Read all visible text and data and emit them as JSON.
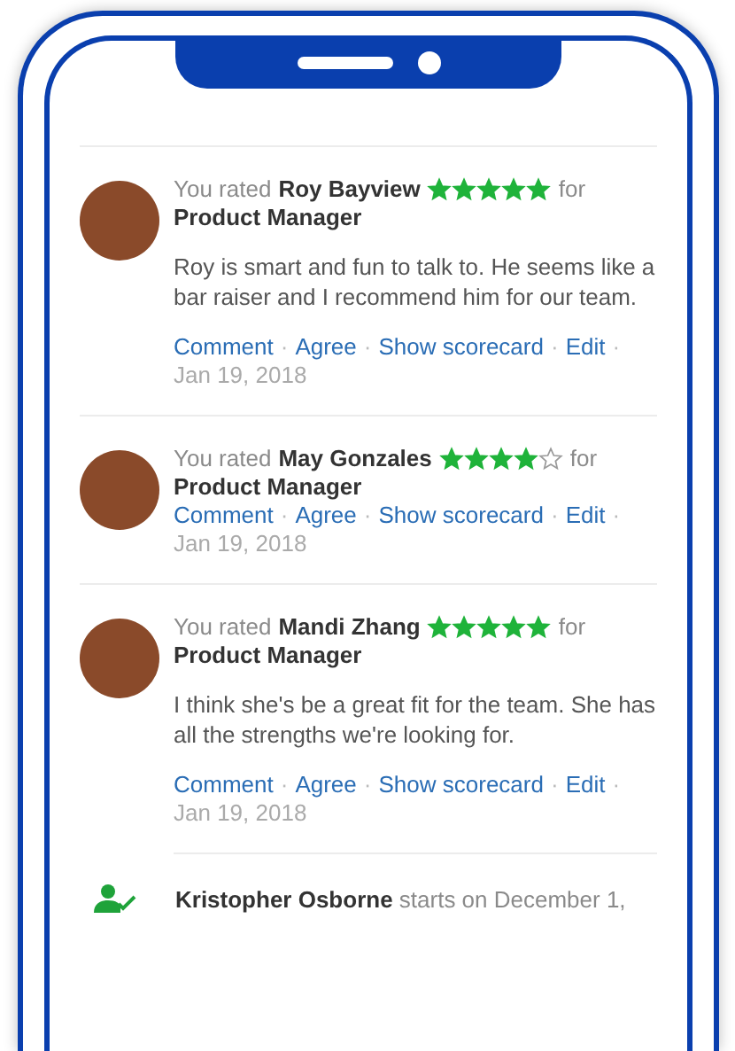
{
  "reviews": [
    {
      "prefix": "You rated",
      "name": "Roy Bayview",
      "stars": 5,
      "connector": "for",
      "role": "Product Manager",
      "comment": "Roy is smart and fun to talk to. He seems like a bar raiser and I recommend him for our team.",
      "actions": [
        "Comment",
        "Agree",
        "Show scorecard",
        "Edit"
      ],
      "date": "Jan 19, 2018"
    },
    {
      "prefix": "You rated",
      "name": "May Gonzales",
      "stars": 4,
      "connector": "for",
      "role": "Product Manager",
      "actions": [
        "Comment",
        "Agree",
        "Show scorecard",
        "Edit"
      ],
      "date": "Jan 19, 2018"
    },
    {
      "prefix": "You rated",
      "name": "Mandi Zhang",
      "stars": 5,
      "connector": "for",
      "role": "Product Manager",
      "comment": "I think she's be a great fit for the team. She has all the strengths we're looking for.",
      "actions": [
        "Comment",
        "Agree",
        "Show scorecard",
        "Edit"
      ],
      "date": "Jan 19, 2018"
    }
  ],
  "separator": "·",
  "hire_notice": {
    "text": "**Kristopher Osborne** starts on December 1,"
  }
}
